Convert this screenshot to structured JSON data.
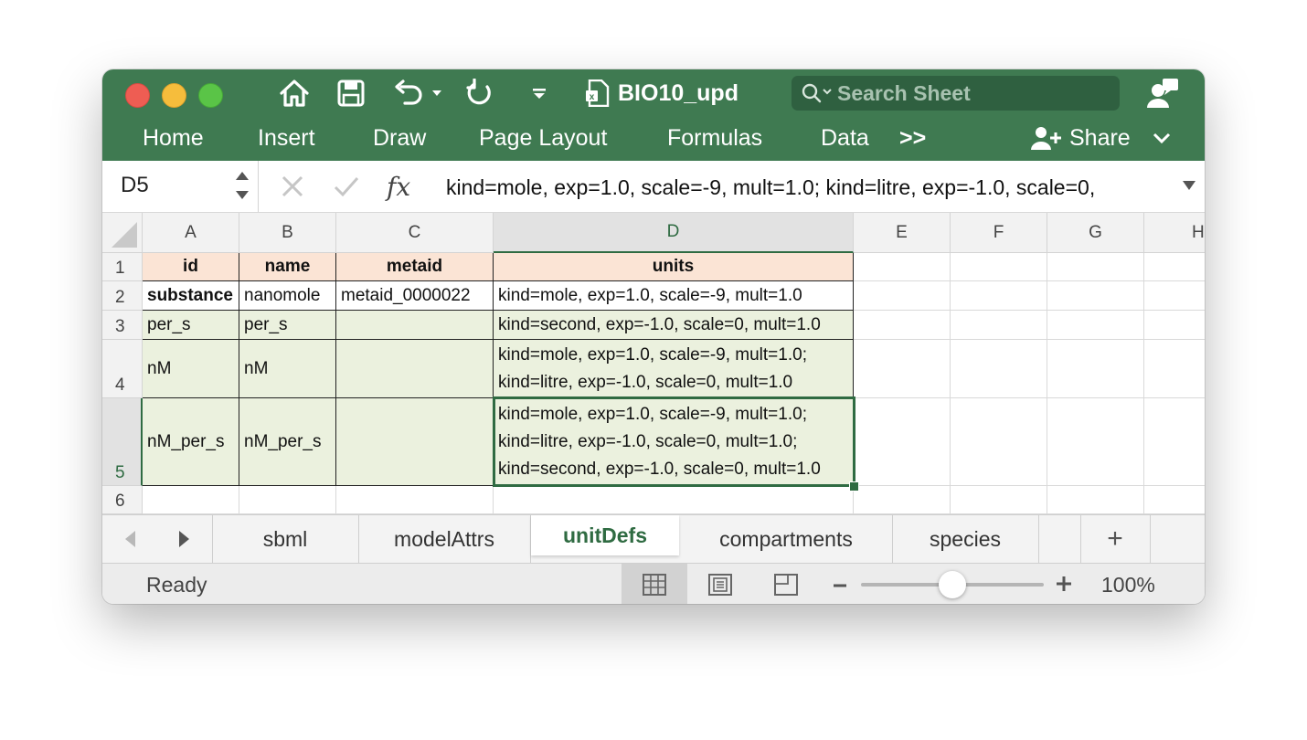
{
  "titlebar": {
    "document_title": "BIO10_upd",
    "search_placeholder": "Search Sheet"
  },
  "ribbon": {
    "tabs": [
      "Home",
      "Insert",
      "Draw",
      "Page Layout",
      "Formulas",
      "Data"
    ],
    "overflow_label": ">>",
    "share_label": "Share"
  },
  "formula_bar": {
    "name_box": "D5",
    "fx_label": "fx",
    "formula": "kind=mole, exp=1.0, scale=-9, mult=1.0; kind=litre, exp=-1.0, scale=0,"
  },
  "grid": {
    "columns": [
      "A",
      "B",
      "C",
      "D",
      "E",
      "F",
      "G",
      "H"
    ],
    "rows": [
      "1",
      "2",
      "3",
      "4",
      "5",
      "6"
    ],
    "header_row": [
      "id",
      "name",
      "metaid",
      "units"
    ],
    "data_rows": [
      {
        "id": "substance",
        "name": "nanomole",
        "metaid": "metaid_0000022",
        "units": [
          "kind=mole, exp=1.0, scale=-9, mult=1.0"
        ]
      },
      {
        "id": "per_s",
        "name": "per_s",
        "metaid": "",
        "units": [
          "kind=second, exp=-1.0, scale=0, mult=1.0"
        ]
      },
      {
        "id": "nM",
        "name": "nM",
        "metaid": "",
        "units": [
          "kind=mole, exp=1.0, scale=-9, mult=1.0;",
          "kind=litre, exp=-1.0, scale=0, mult=1.0"
        ]
      },
      {
        "id": "nM_per_s",
        "name": "nM_per_s",
        "metaid": "",
        "units": [
          "kind=mole, exp=1.0, scale=-9, mult=1.0;",
          "kind=litre, exp=-1.0, scale=0, mult=1.0;",
          "kind=second, exp=-1.0, scale=0, mult=1.0"
        ]
      }
    ],
    "selected_cell": "D5"
  },
  "sheet_tabs": {
    "tabs": [
      "sbml",
      "modelAttrs",
      "unitDefs",
      "compartments",
      "species"
    ],
    "active": "unitDefs",
    "add_label": "+"
  },
  "status_bar": {
    "status": "Ready",
    "zoom": "100%",
    "zoom_fraction": 0.5
  },
  "colors": {
    "title_green": "#3f7a51",
    "header_fill": "#fbe4d5",
    "row_fill": "#ebf1de",
    "selection": "#2f6b42"
  }
}
